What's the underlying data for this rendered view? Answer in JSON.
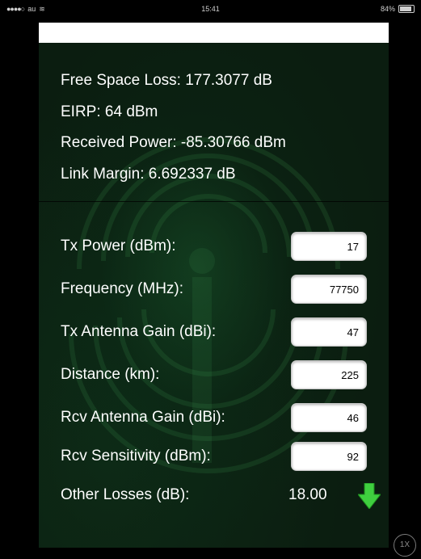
{
  "status_bar": {
    "carrier": "au",
    "time": "15:41",
    "battery": "84%"
  },
  "results": [
    "Free Space Loss: 177.3077 dB",
    "EIRP: 64 dBm",
    "Received Power: -85.30766 dBm",
    "Link Margin: 6.692337 dB"
  ],
  "fields": [
    {
      "label": "Tx  Power (dBm):",
      "value": "17"
    },
    {
      "label": "Frequency (MHz):",
      "value": "77750"
    },
    {
      "label": "Tx Antenna Gain (dBi):",
      "value": "47"
    },
    {
      "label": "Distance (km):",
      "value": "225"
    },
    {
      "label": "Rcv Antenna Gain (dBi):",
      "value": "46"
    },
    {
      "label": "Rcv Sensitivity (dBm):",
      "value": "92"
    }
  ],
  "other_losses": {
    "label": "Other Losses (dB):",
    "value": "18.00",
    "icon": "down-arrow-icon",
    "icon_color": "#3fcf3f"
  },
  "zoom_button": "1X",
  "colors": {
    "background": "#0b1d10",
    "accent_green": "#3fcf3f"
  }
}
